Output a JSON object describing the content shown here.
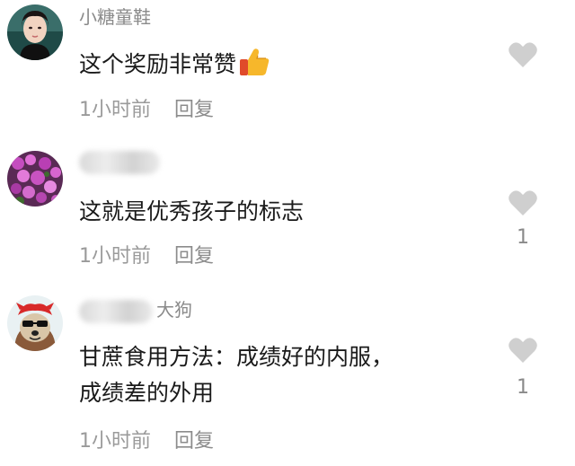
{
  "comments": [
    {
      "username": "小糖童鞋",
      "text": "这个奖励非常赞",
      "time": "1小时前",
      "reply": "回复",
      "likes": ""
    },
    {
      "username": "",
      "text": "这就是优秀孩子的标志",
      "time": "1小时前",
      "reply": "回复",
      "likes": "1"
    },
    {
      "username": "大狗",
      "text_line1": "甘蔗食用方法：成绩好的内服，",
      "text_line2": "成绩差的外用",
      "time": "1小时前",
      "reply": "回复",
      "likes": "1"
    }
  ],
  "colors": {
    "like_icon": "#cfcfcf",
    "meta_text": "#9a9a9a",
    "body_text": "#1a1a1a"
  },
  "icons": {
    "like": "heart-icon",
    "emoji": "thumbs-up-emoji"
  }
}
